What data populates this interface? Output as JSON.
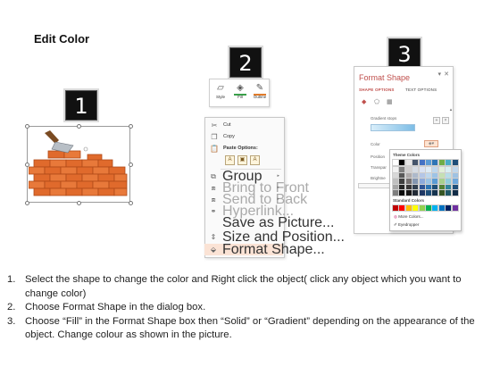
{
  "title": "Edit Color",
  "steps": [
    "1",
    "2",
    "3"
  ],
  "mini_toolbar": {
    "style_label": "Style",
    "fill_label": "Fill",
    "outline_label": "Outline",
    "fill_bar_color": "#3aa04a",
    "outline_bar_color": "#e07b2a"
  },
  "context_menu": {
    "items": [
      {
        "label": "Cut",
        "icon": "scissors-icon",
        "enabled": true,
        "submenu": false
      },
      {
        "label": "Copy",
        "icon": "copy-icon",
        "enabled": true,
        "submenu": false
      },
      {
        "label": "Paste Options:",
        "icon": "paste-icon",
        "enabled": true,
        "submenu": false
      },
      {
        "label": "Group",
        "icon": "group-icon",
        "enabled": true,
        "submenu": true
      },
      {
        "label": "Bring to Front",
        "icon": "bring-front-icon",
        "enabled": false,
        "submenu": true
      },
      {
        "label": "Send to Back",
        "icon": "send-back-icon",
        "enabled": false,
        "submenu": true
      },
      {
        "label": "Hyperlink...",
        "icon": "hyperlink-icon",
        "enabled": false,
        "submenu": false
      },
      {
        "label": "Save as Picture...",
        "icon": "",
        "enabled": true,
        "submenu": false
      },
      {
        "label": "Size and Position...",
        "icon": "size-icon",
        "enabled": true,
        "submenu": false
      },
      {
        "label": "Format Shape...",
        "icon": "format-shape-icon",
        "enabled": true,
        "submenu": false,
        "highlighted": true
      }
    ]
  },
  "format_pane": {
    "title": "Format Shape",
    "tabs": [
      "SHAPE OPTIONS",
      "TEXT OPTIONS"
    ],
    "gradient_stops_label": "Gradient stops",
    "color_label": "Color",
    "position_label": "Position",
    "transparency_label": "Transpar",
    "brightness_label": "Brightne"
  },
  "palette": {
    "theme_colors_label": "Theme Colors",
    "standard_colors_label": "Standard Colors",
    "more_colors_label": "More Colors...",
    "eyedropper_label": "Eyedropper",
    "theme_top_row": [
      "#ffffff",
      "#000000",
      "#e7e6e6",
      "#44546a",
      "#4472c4",
      "#5b9bd5",
      "#2e75b6",
      "#70ad47",
      "#4bacc6",
      "#1f4e79"
    ],
    "shade_rows": [
      [
        "#f2f2f2",
        "#7f7f7f",
        "#d0cece",
        "#d6dce4",
        "#d9e2f3",
        "#deebf6",
        "#bdd7ee",
        "#e2efd9",
        "#daeef3",
        "#c0d7ec"
      ],
      [
        "#d8d8d8",
        "#595959",
        "#aeaaaa",
        "#adb9ca",
        "#b4c6e7",
        "#bdd7ee",
        "#9dc3e6",
        "#c5e0b3",
        "#b7dde8",
        "#9ec2e3"
      ],
      [
        "#bfbfbf",
        "#3f3f3f",
        "#757070",
        "#8496b0",
        "#8eaadb",
        "#9cc3e5",
        "#5b9bd5",
        "#a8d08d",
        "#92cddc",
        "#6fa8dc"
      ],
      [
        "#a5a5a5",
        "#262626",
        "#3a3838",
        "#323f4f",
        "#2f5496",
        "#2e75b5",
        "#1f4e79",
        "#538135",
        "#31849b",
        "#1f4e79"
      ],
      [
        "#7f7f7f",
        "#0c0c0c",
        "#171616",
        "#222a35",
        "#1f3864",
        "#1e4e79",
        "#14334f",
        "#375623",
        "#205867",
        "#112b47"
      ]
    ],
    "standard_colors": [
      "#c00000",
      "#ff0000",
      "#ffc000",
      "#ffff00",
      "#92d050",
      "#00b050",
      "#00b0f0",
      "#0070c0",
      "#002060",
      "#7030a0"
    ]
  },
  "instructions": [
    {
      "number": "1.",
      "text": "Select the shape to change the color and Right click the object( click any object which you want to change color)"
    },
    {
      "number": "2.",
      "text": "Choose Format Shape in the dialog box."
    },
    {
      "number": "3.",
      "text": "Choose “Fill” in the Format Shape box then “Solid” or “Gradient” depending on the appearance of the object. Change colour as shown in the picture."
    }
  ],
  "colors": {
    "accent_title": "#c0504d",
    "brick": "#e06a2c",
    "brick_highlight": "#f5a15c",
    "menu_highlight": "#fbe3d5"
  }
}
